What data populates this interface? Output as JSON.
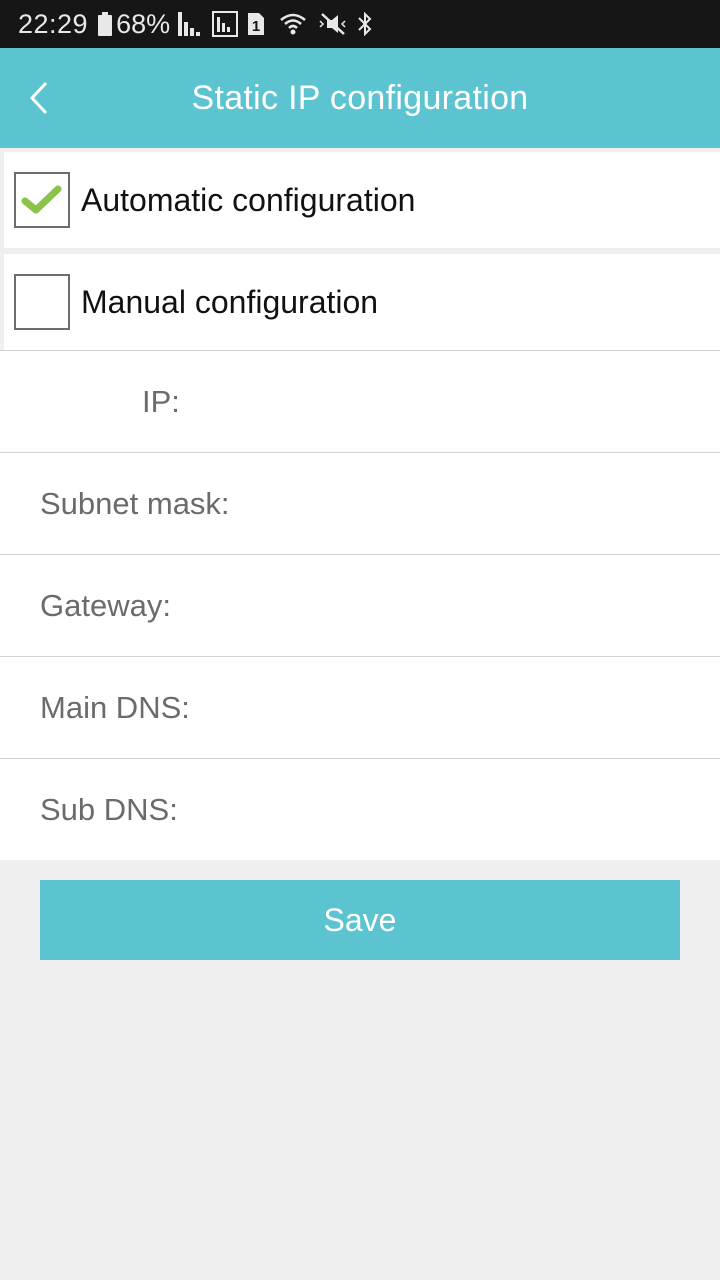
{
  "status_bar": {
    "time": "22:29",
    "battery": "68%",
    "sim_slot": "1",
    "icons": [
      "battery-icon",
      "signal-icon",
      "signal-sim-icon",
      "sim-1-icon",
      "wifi-icon",
      "mute-icon",
      "bluetooth-icon"
    ]
  },
  "app_bar": {
    "title": "Static IP configuration",
    "back_icon": "chevron-left-icon",
    "color": "#5cc3d0"
  },
  "options": {
    "automatic": {
      "label": "Automatic configuration",
      "checked": true
    },
    "manual": {
      "label": "Manual configuration",
      "checked": false
    }
  },
  "fields": {
    "ip": {
      "label": "IP:",
      "value": ""
    },
    "subnet_mask": {
      "label": "Subnet mask:",
      "value": ""
    },
    "gateway": {
      "label": "Gateway:",
      "value": ""
    },
    "main_dns": {
      "label": "Main DNS:",
      "value": ""
    },
    "sub_dns": {
      "label": "Sub DNS:",
      "value": ""
    }
  },
  "save_button": {
    "label": "Save"
  },
  "colors": {
    "accent": "#5cc3d0",
    "check_mark": "#8bc34a",
    "background": "#efefef"
  }
}
